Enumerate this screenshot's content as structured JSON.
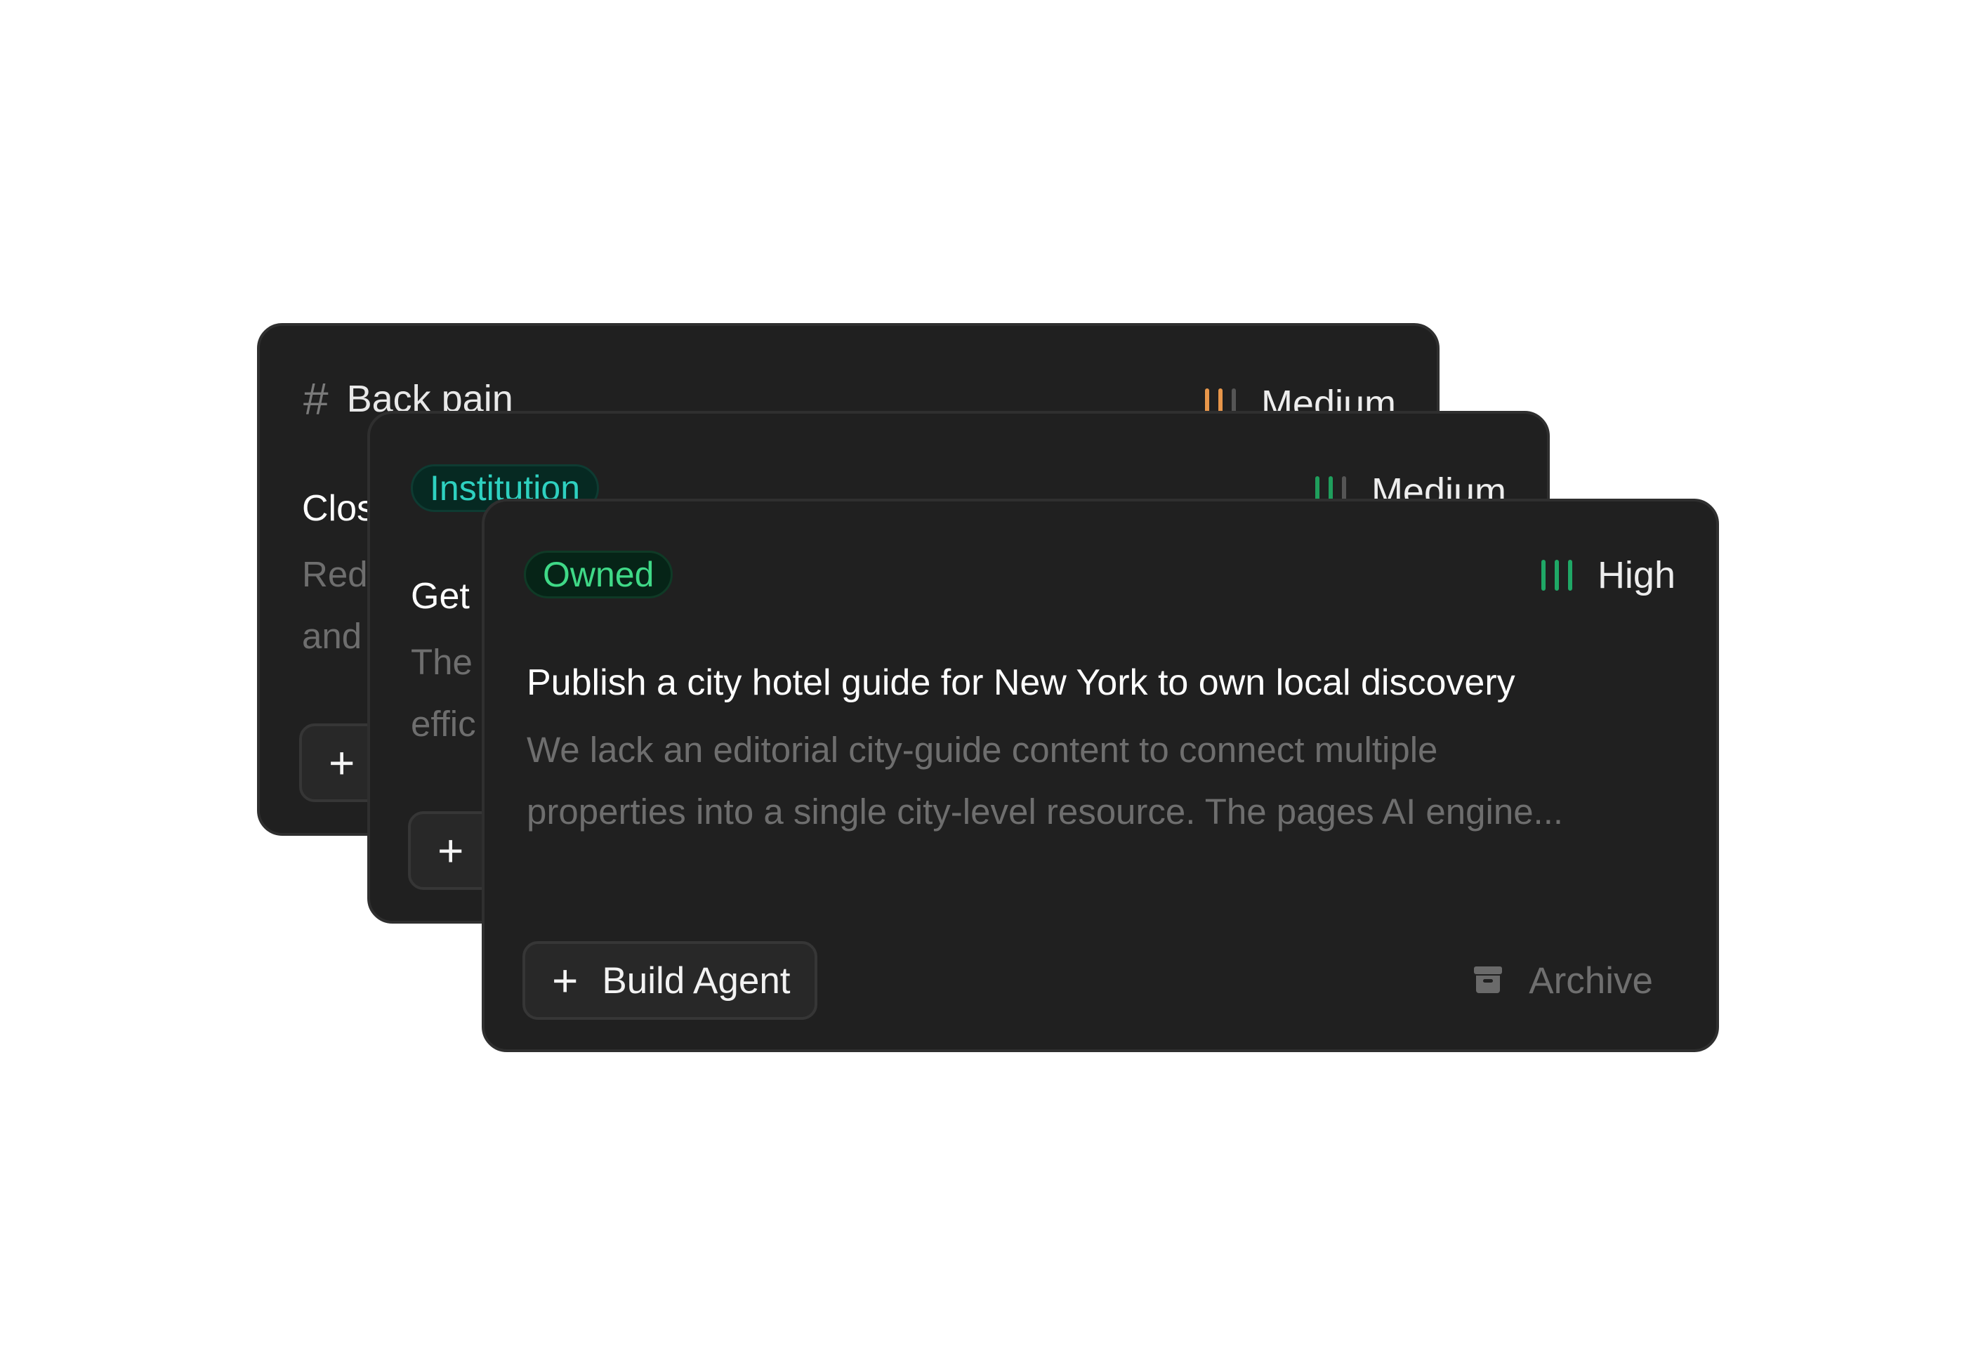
{
  "cards": [
    {
      "tag": "Back pain",
      "tag_icon": "hash-icon",
      "priority": {
        "label": "Medium",
        "level": 2,
        "of": 3,
        "color": "#e8964a"
      },
      "title": "Clos",
      "description_lines": [
        "Red",
        "and"
      ],
      "button": {
        "icon": "plus-icon",
        "label": "+"
      }
    },
    {
      "badge": "Institution",
      "priority": {
        "label": "Medium",
        "level": 2,
        "of": 3,
        "color": "#1f9e5c"
      },
      "title": "Get",
      "description_lines": [
        "The",
        "effic"
      ],
      "button": {
        "icon": "plus-icon",
        "label": "+"
      }
    },
    {
      "badge": "Owned",
      "priority": {
        "label": "High",
        "level": 3,
        "of": 3,
        "color": "#1fa866"
      },
      "title": "Publish a city hotel guide for New York to own local discovery",
      "description_lines": [
        "We lack an editorial city-guide content to connect multiple",
        "properties into a single city-level resource. The pages AI engine..."
      ],
      "build_button": {
        "label": "Build Agent",
        "icon": "plus-icon"
      },
      "archive": {
        "label": "Archive",
        "icon": "archive-icon"
      }
    }
  ],
  "colors": {
    "card_background": "#202020",
    "institution_text": "#2ed1c0",
    "owned_text": "#3fd987"
  }
}
